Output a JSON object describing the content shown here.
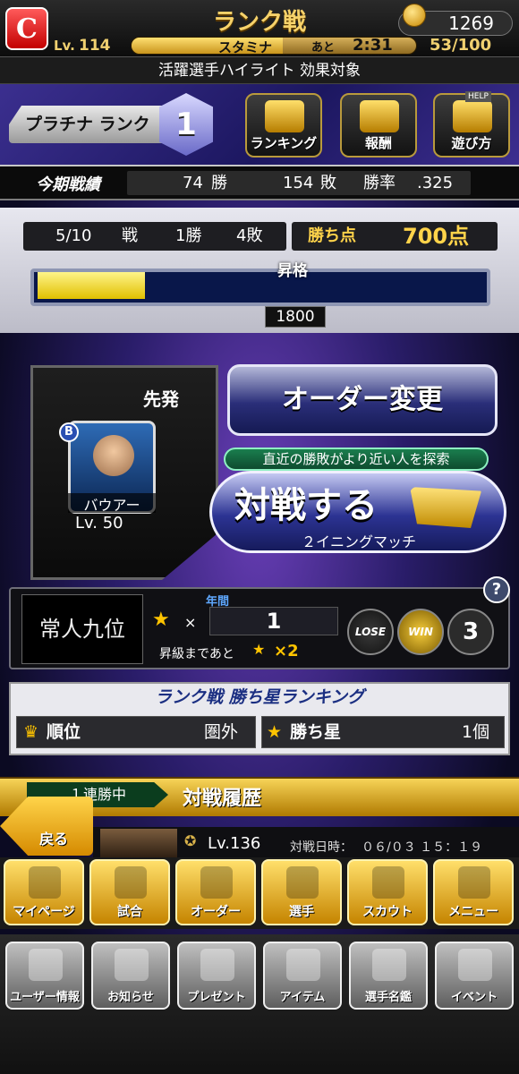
{
  "header": {
    "title": "ランク戦",
    "coins": "1269",
    "level_prefix": "Lv.",
    "level": "114",
    "stamina_label": "スタミナ",
    "stamina_remaining_prefix": "あと",
    "stamina_time": "2:31",
    "stamina_count": "53/100",
    "stamina_fraction": 0.53
  },
  "event_strip": "活躍選手ハイライト 効果対象",
  "rank": {
    "name": "プラチナ ランク",
    "number": "1",
    "buttons": [
      {
        "label": "ランキング",
        "icon": "crown-icon"
      },
      {
        "label": "報酬",
        "icon": "treasure-chest-icon"
      },
      {
        "label": "遊び方",
        "icon": "help-robot-icon",
        "tag": "HELP"
      }
    ]
  },
  "season": {
    "label": "今期戦績",
    "wins": "74",
    "wins_unit": "勝",
    "losses": "154",
    "losses_unit": "敗",
    "rate_label": "勝率",
    "rate": ".325"
  },
  "match": {
    "progress": "5/10",
    "progress_unit": "戦",
    "wins": "1勝",
    "losses": "4敗",
    "points_label": "勝ち点",
    "points": "700点",
    "promotion_label": "昇格",
    "promotion_target": "1800",
    "promotion_fraction": 0.24
  },
  "starter": {
    "label": "先発",
    "type": "B",
    "player_name": "バウアー",
    "player_level": "Lv. 50"
  },
  "actions": {
    "order_change": "オーダー変更",
    "search_hint": "直近の勝敗がより近い人を探索",
    "battle": "対戦する",
    "battle_sub": "２イニングマッチ"
  },
  "record": {
    "emblem": "常人九位",
    "year_label": "年間",
    "star_prefix": "×",
    "star_count": "1",
    "promotion_need": "昇級まであと",
    "promotion_need_value": "×2",
    "lose_label": "LOSE",
    "win_label": "WIN",
    "streak": "3",
    "help": "?"
  },
  "ranking": {
    "title": "ランク戦 勝ち星ランキング",
    "rank_label": "順位",
    "rank_value": "圏外",
    "stars_label": "勝ち星",
    "stars_value": "1個"
  },
  "history": {
    "streak": "１連勝中",
    "title": "対戦履歴",
    "back": "戻る",
    "opponent_level": "Lv.136",
    "date_label": "対戦日時：",
    "date": "０６/０３ １５：１９"
  },
  "nav_main": [
    {
      "label": "マイページ",
      "icon": "home-icon"
    },
    {
      "label": "試合",
      "icon": "baseball-diamond-icon"
    },
    {
      "label": "オーダー",
      "icon": "lineup-icon"
    },
    {
      "label": "選手",
      "icon": "player-icon"
    },
    {
      "label": "スカウト",
      "icon": "scout-icon"
    },
    {
      "label": "メニュー",
      "icon": "menu-robot-icon"
    }
  ],
  "nav_sub": [
    {
      "label": "ユーザー情報",
      "icon": "user-info-icon"
    },
    {
      "label": "お知らせ",
      "icon": "notice-icon"
    },
    {
      "label": "プレゼント",
      "icon": "gift-icon"
    },
    {
      "label": "アイテム",
      "icon": "item-book-icon"
    },
    {
      "label": "選手名鑑",
      "icon": "player-book-icon"
    },
    {
      "label": "イベント",
      "icon": "event-bat-icon"
    }
  ]
}
